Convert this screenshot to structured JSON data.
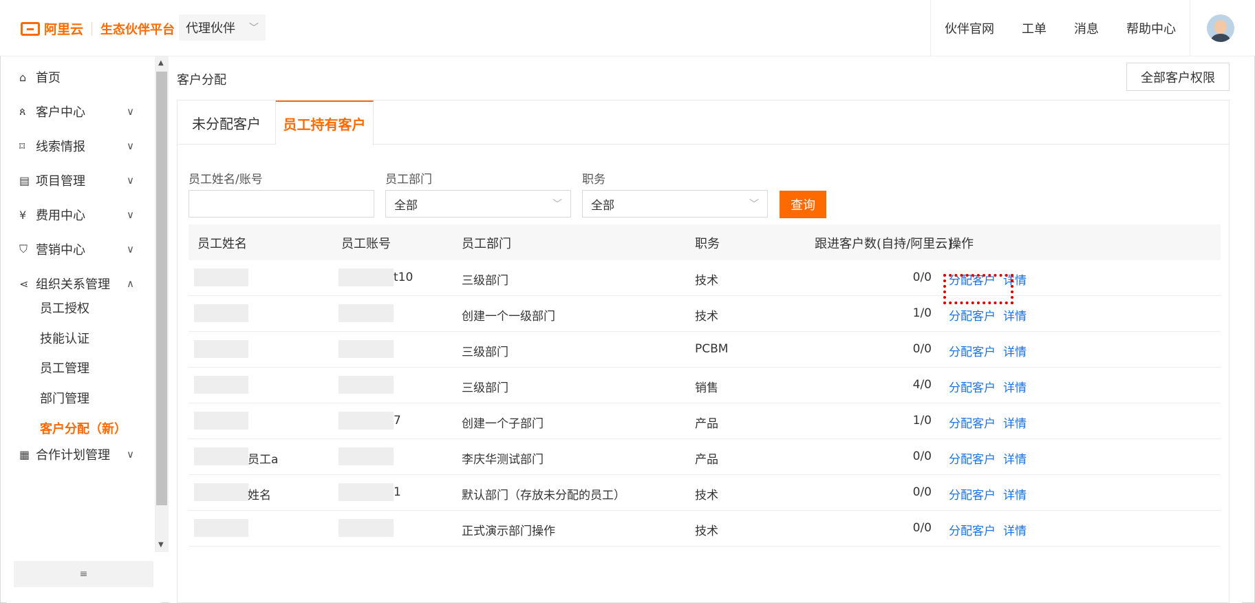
{
  "header": {
    "logo_text": "阿里云",
    "platform": "生态伙伴平台",
    "partner_type": "代理伙伴",
    "nav": [
      "伙伴官网",
      "工单",
      "消息",
      "帮助中心"
    ]
  },
  "sidebar": {
    "items": [
      {
        "label": "首页",
        "icon": "home-icon",
        "glyph": "⌂",
        "chevron": ""
      },
      {
        "label": "客户中心",
        "icon": "customer-icon",
        "glyph": "ጰ",
        "chevron": "∨"
      },
      {
        "label": "线索情报",
        "icon": "leads-icon",
        "glyph": "⌑",
        "chevron": "∨"
      },
      {
        "label": "项目管理",
        "icon": "project-icon",
        "glyph": "▤",
        "chevron": "∨"
      },
      {
        "label": "费用中心",
        "icon": "fee-icon",
        "glyph": "¥",
        "chevron": "∨"
      },
      {
        "label": "营销中心",
        "icon": "marketing-icon",
        "glyph": "⛉",
        "chevron": "∨"
      },
      {
        "label": "组织关系管理",
        "icon": "org-icon",
        "glyph": "⋖",
        "chevron": "∧"
      }
    ],
    "sub_items": [
      "员工授权",
      "技能认证",
      "员工管理",
      "部门管理",
      "客户分配（新）"
    ],
    "bottom_item": {
      "label": "合作计划管理",
      "icon": "plan-icon",
      "glyph": "▦",
      "chevron": "∨"
    },
    "collapse_glyph": "≡"
  },
  "main": {
    "title": "客户分配",
    "perm_button": "全部客户权限",
    "tabs": [
      "未分配客户",
      "员工持有客户"
    ],
    "active_tab": 1,
    "filters": {
      "name_label": "员工姓名/账号",
      "name_value": "",
      "dept_label": "员工部门",
      "dept_value": "全部",
      "role_label": "职务",
      "role_value": "全部",
      "query_button": "查询"
    },
    "table": {
      "headers": [
        "员工姓名",
        "员工账号",
        "员工部门",
        "职务",
        "跟进客户数(自持/阿里云)",
        "操作"
      ],
      "rows": [
        {
          "name": "",
          "account": "t10",
          "dept": "三级部门",
          "role": "技术",
          "count": "0/0"
        },
        {
          "name": "",
          "account": "",
          "dept": "创建一个一级部门",
          "role": "技术",
          "count": "1/0"
        },
        {
          "name": "",
          "account": "",
          "dept": "三级部门",
          "role": "PCBM",
          "count": "0/0"
        },
        {
          "name": "",
          "account": "",
          "dept": "三级部门",
          "role": "销售",
          "count": "4/0"
        },
        {
          "name": "",
          "account": "7",
          "dept": "创建一个子部门",
          "role": "产品",
          "count": "1/0"
        },
        {
          "name": "员工a",
          "account": "",
          "dept": "李庆华测试部门",
          "role": "产品",
          "count": "0/0"
        },
        {
          "name": "姓名",
          "account": "1",
          "dept": "默认部门（存放未分配的员工）",
          "role": "技术",
          "count": "0/0"
        },
        {
          "name": "",
          "account": "",
          "dept": "正式演示部门操作",
          "role": "技术",
          "count": "0/0"
        }
      ],
      "action_assign": "分配客户",
      "action_detail": "详情"
    }
  },
  "colors": {
    "accent": "#ff6a00",
    "link": "#1a73e8",
    "highlight": "#e00000"
  }
}
